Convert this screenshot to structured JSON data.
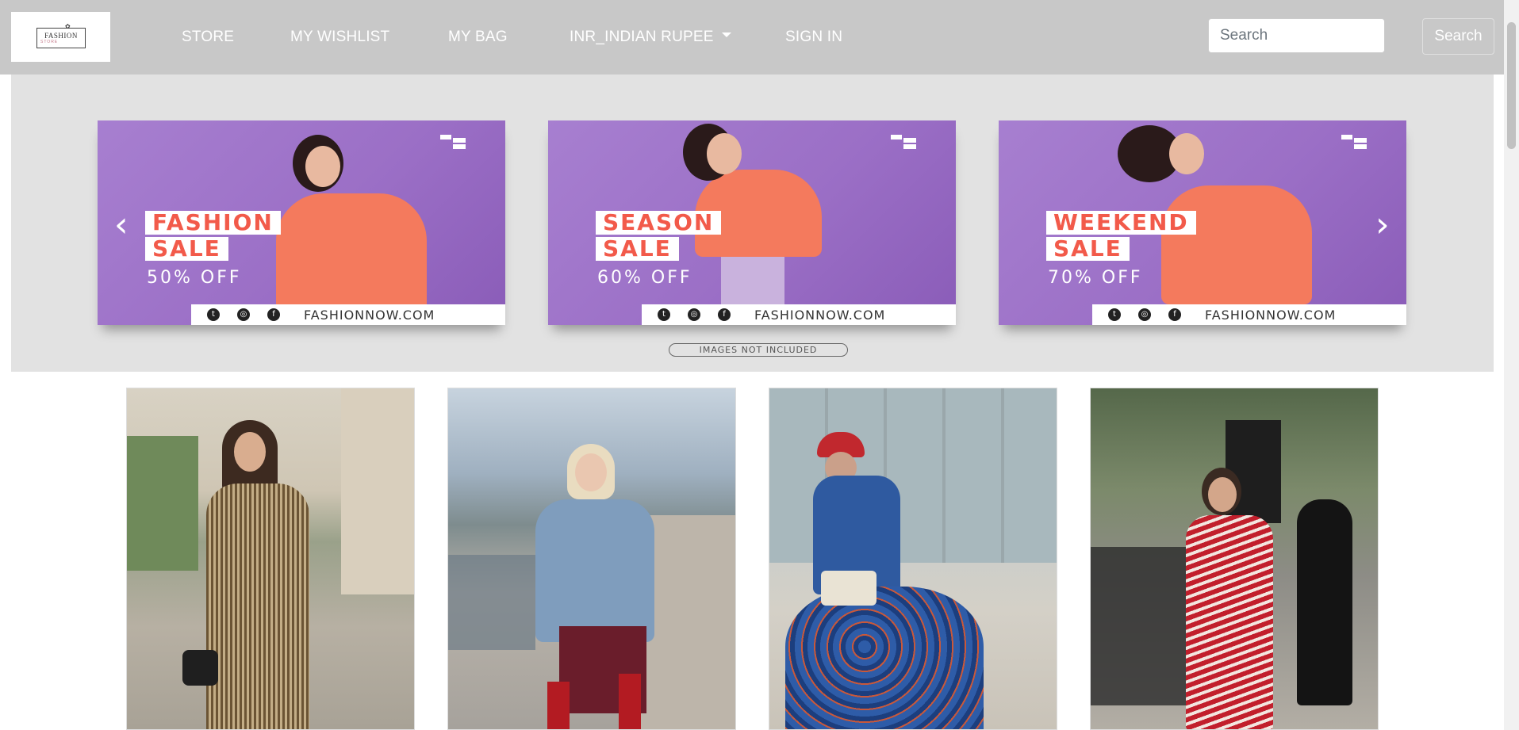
{
  "logo": {
    "text": "FASHION",
    "subtext": "STORE",
    "icon": "fashion-store-logo"
  },
  "nav": {
    "items": [
      {
        "label": "STORE"
      },
      {
        "label": "MY WISHLIST"
      },
      {
        "label": "MY BAG"
      },
      {
        "label": "INR_INDIAN RUPEE",
        "dropdown": true
      },
      {
        "label": "SIGN IN"
      }
    ],
    "search_placeholder": "Search",
    "search_button": "Search"
  },
  "carousel": {
    "prev_icon": "chevron-left-icon",
    "next_icon": "chevron-right-icon",
    "slides": [
      {
        "line1": "FASHION",
        "line2": "SALE",
        "discount": "50% OFF",
        "url": "FASHIONNOW.COM"
      },
      {
        "line1": "SEASON",
        "line2": "SALE",
        "discount": "60% OFF",
        "url": "FASHIONNOW.COM"
      },
      {
        "line1": "WEEKEND",
        "line2": "SALE",
        "discount": "70% OFF",
        "url": "FASHIONNOW.COM"
      }
    ],
    "caption": "IMAGES NOT INCLUDED"
  },
  "products": [
    {
      "image": "woman-in-striped-dress-street"
    },
    {
      "image": "woman-in-denim-jacket-red-boots"
    },
    {
      "image": "woman-in-blue-paisley-dress-red-beret"
    },
    {
      "image": "woman-in-red-chevron-dress"
    }
  ],
  "colors": {
    "navbar": "#c8c8c8",
    "carousel_bg": "#e2e2e2",
    "slide_purple": "#9b6fc6",
    "sale_red": "#f25a4a",
    "sweater_coral": "#f47a5d"
  }
}
